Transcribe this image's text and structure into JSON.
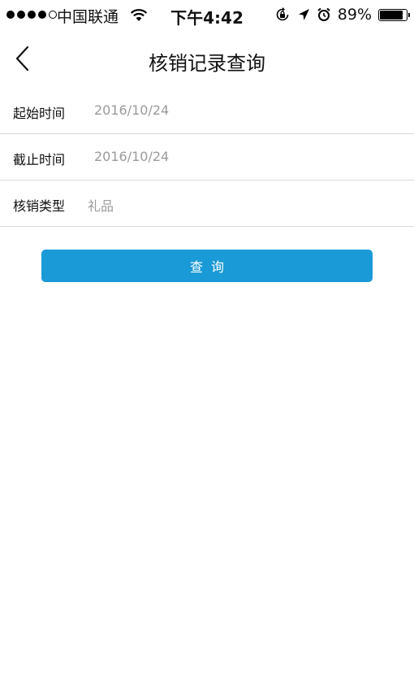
{
  "status_bar": {
    "carrier": "中国联通",
    "time": "下午4:42",
    "battery_percent": "89%",
    "battery_level": 0.89,
    "icons": [
      "signal-dots-icon",
      "wifi-icon",
      "rotation-lock-icon",
      "location-arrow-icon",
      "alarm-icon",
      "battery-icon"
    ]
  },
  "nav": {
    "title": "核销记录查询",
    "back_icon": "chevron-left-icon"
  },
  "form": {
    "start_time": {
      "label": "起始时间",
      "value": "2016/10/24"
    },
    "end_time": {
      "label": "截止时间",
      "value": "2016/10/24"
    },
    "verify_type": {
      "label": "核销类型",
      "value": "礼品"
    }
  },
  "query_button": {
    "label": "查询"
  },
  "colors": {
    "accent": "#1a9ad6",
    "placeholder": "#9a9a9a",
    "divider": "#d9d9d9"
  }
}
